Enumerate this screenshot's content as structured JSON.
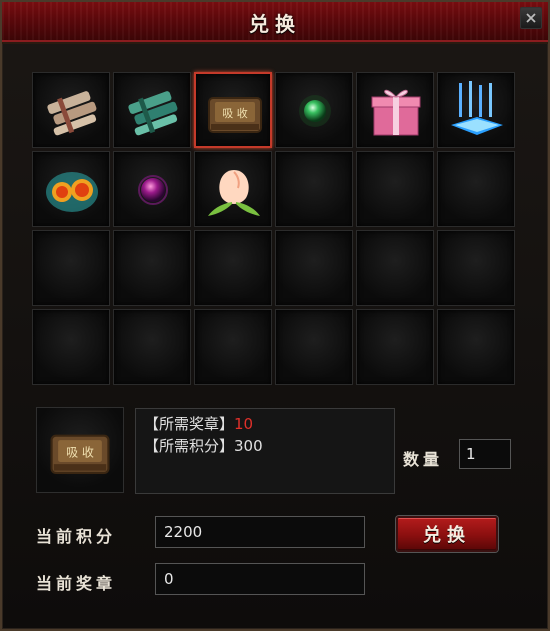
{
  "window": {
    "title": "兑换"
  },
  "grid": {
    "items": [
      {
        "name": "scroll-bundle-icon"
      },
      {
        "name": "jade-bundle-icon"
      },
      {
        "name": "chest-icon",
        "selected": true
      },
      {
        "name": "green-orb-icon"
      },
      {
        "name": "gift-box-icon"
      },
      {
        "name": "blue-crystal-icon"
      },
      {
        "name": "fire-orbs-icon"
      },
      {
        "name": "purple-gem-icon"
      },
      {
        "name": "peach-icon"
      }
    ]
  },
  "requirement": {
    "medal_label": "【所需奖章】",
    "medal_value": "10",
    "points_label": "【所需积分】",
    "points_value": "300"
  },
  "quantity": {
    "label": "数量",
    "value": "1"
  },
  "current_points": {
    "label": "当前积分",
    "value": "2200"
  },
  "current_medals": {
    "label": "当前奖章",
    "value": "0"
  },
  "exchange_button": {
    "label": "兑换"
  }
}
